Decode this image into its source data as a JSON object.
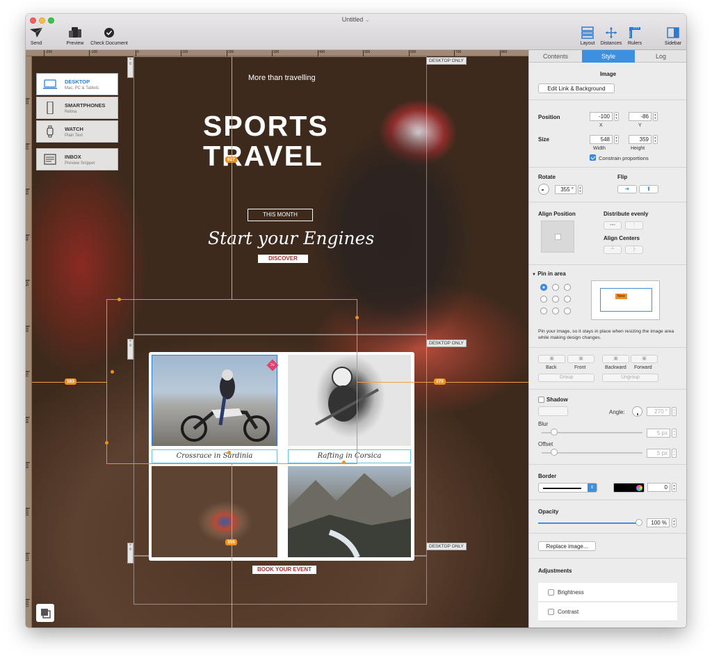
{
  "window": {
    "title": "Untitled",
    "title_chevron": "⌄"
  },
  "toolbar": {
    "send": "Send",
    "preview": "Preview",
    "check_document": "Check Document",
    "layout": "Layout",
    "distances": "Distances",
    "rulers": "Rulers",
    "sidebar": "Sidebar"
  },
  "ruler": {
    "top": [
      "-200",
      "-100",
      "0",
      "100",
      "200",
      "300",
      "400",
      "500",
      "600",
      "700",
      "800"
    ],
    "left": [
      "100",
      "200",
      "300",
      "400",
      "500",
      "600",
      "700",
      "800",
      "900",
      "1000",
      "1100",
      "1200"
    ]
  },
  "devices": [
    {
      "name": "DESKTOP",
      "sub": "Mac, PC & Tablets",
      "active": true
    },
    {
      "name": "SMARTPHONES",
      "sub": "Retina",
      "active": false
    },
    {
      "name": "WATCH",
      "sub": "Plain Text",
      "active": false
    },
    {
      "name": "INBOX",
      "sub": "Preview Snippet",
      "active": false
    }
  ],
  "canvas": {
    "desktop_only": "DESKTOP ONLY",
    "tagline": "More than travelling",
    "title_line1": "SPORTS",
    "title_line2": "TRAVEL",
    "this_month": "THIS MONTH",
    "script_heading": "Start your Engines",
    "discover": "DISCOVER",
    "book_event": "BOOK YOUR EVENT",
    "caption1": "Crossrace in Sardinia",
    "caption2": "Rafting in Corsica",
    "badge_2x": "2x",
    "section_close": "×",
    "section_menu": "≡",
    "measure_top": "627",
    "measure_left": "163",
    "measure_right": "375",
    "measure_bottom": "355"
  },
  "sidebar": {
    "tabs": [
      "Contents",
      "Style",
      "Log"
    ],
    "active_tab": "Style",
    "section_title": "Image",
    "edit_link_button": "Edit Link & Background",
    "position_label": "Position",
    "position_x": "-100",
    "position_y": "-86",
    "x_label": "X",
    "y_label": "Y",
    "size_label": "Size",
    "width_value": "548",
    "height_value": "359",
    "width_label": "Width",
    "height_label": "Height",
    "constrain_label": "Constrain proportions",
    "rotate_label": "Rotate",
    "rotate_value": "355 °",
    "flip_label": "Flip",
    "align_position_label": "Align Position",
    "distribute_label": "Distribute evenly",
    "align_centers_label": "Align Centers",
    "pin_label": "Pin in area",
    "pin_new": "New",
    "pin_desc": "Pin your image, so it stays in place when resizing the image area while making design changes.",
    "back": "Back",
    "front": "Front",
    "backward": "Backward",
    "forward": "Forward",
    "group": "Group",
    "ungroup": "Ungroup",
    "shadow_label": "Shadow",
    "angle_label": "Angle:",
    "angle_value": "270 °",
    "blur_label": "Blur",
    "blur_value": "5 px",
    "offset_label": "Offset",
    "offset_value": "5 px",
    "border_label": "Border",
    "border_width": "0",
    "opacity_label": "Opacity",
    "opacity_value": "100 %",
    "opacity_level": 1.0,
    "replace_button": "Replace image...",
    "adjustments_label": "Adjustments",
    "brightness": "Brightness",
    "contrast": "Contrast"
  },
  "colors": {
    "accent": "#3d8fe0",
    "guide": "#f0901e",
    "badge": "#e5406a"
  }
}
